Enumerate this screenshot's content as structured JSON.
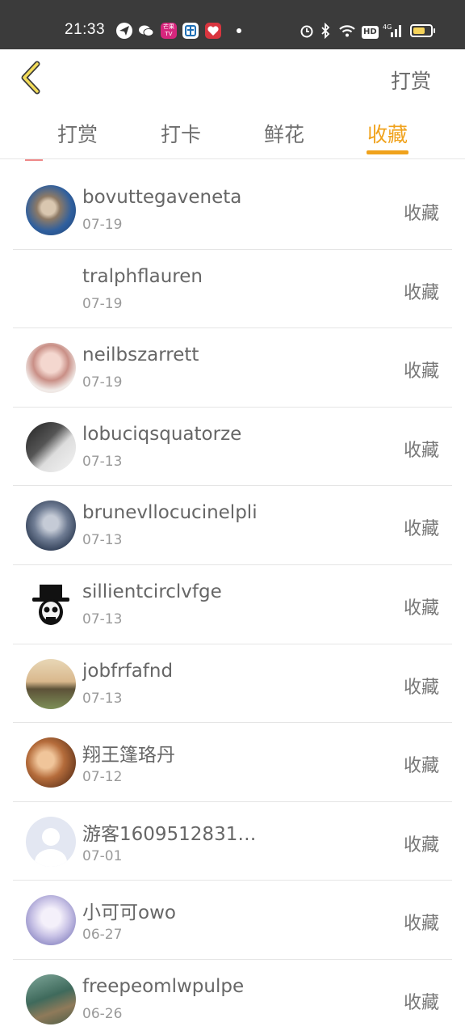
{
  "status_bar": {
    "time": "21:33",
    "network": "4G",
    "hd": "HD",
    "battery_level": 0.7,
    "icons": [
      "paperplane-app-icon",
      "wechat-icon",
      "mango-tv-icon",
      "bank-app-icon",
      "heart-app-icon",
      "alarm-icon",
      "bluetooth-icon",
      "wifi-icon",
      "hd-icon",
      "signal-icon",
      "battery-icon"
    ]
  },
  "nav": {
    "back_icon": "chevron-left-icon",
    "title_right": "打赏"
  },
  "tabs": [
    {
      "label": "打赏",
      "active": false
    },
    {
      "label": "打卡",
      "active": false
    },
    {
      "label": "鲜花",
      "active": false
    },
    {
      "label": "收藏",
      "active": true
    }
  ],
  "accent_color": "#f0a21c",
  "list": [
    {
      "name": "bovuttegaveneta",
      "date": "07-19",
      "action": "收藏",
      "avatar": "kitten"
    },
    {
      "name": "tralphflauren",
      "date": "07-19",
      "action": "收藏",
      "avatar": "none"
    },
    {
      "name": "neilbszarrett",
      "date": "07-19",
      "action": "收藏",
      "avatar": "girl-pink"
    },
    {
      "name": "lobuciqsquatorze",
      "date": "07-13",
      "action": "收藏",
      "avatar": "bw-portrait"
    },
    {
      "name": "brunevllocucinelpli",
      "date": "07-13",
      "action": "收藏",
      "avatar": "blue-girl"
    },
    {
      "name": "sillientcirclvfge",
      "date": "07-13",
      "action": "收藏",
      "avatar": "skull-tophat"
    },
    {
      "name": "jobfrfafnd",
      "date": "07-13",
      "action": "收藏",
      "avatar": "sunset-person"
    },
    {
      "name": "翔王篷珞丹",
      "date": "07-12",
      "action": "收藏",
      "avatar": "warm-portrait"
    },
    {
      "name": "游客1609512831…",
      "date": "07-01",
      "action": "收藏",
      "avatar": "default-silhouette"
    },
    {
      "name": "小可可owo",
      "date": "06-27",
      "action": "收藏",
      "avatar": "anime-girl"
    },
    {
      "name": "freepeomlwpulpe",
      "date": "06-26",
      "action": "收藏",
      "avatar": "green-scene"
    }
  ]
}
